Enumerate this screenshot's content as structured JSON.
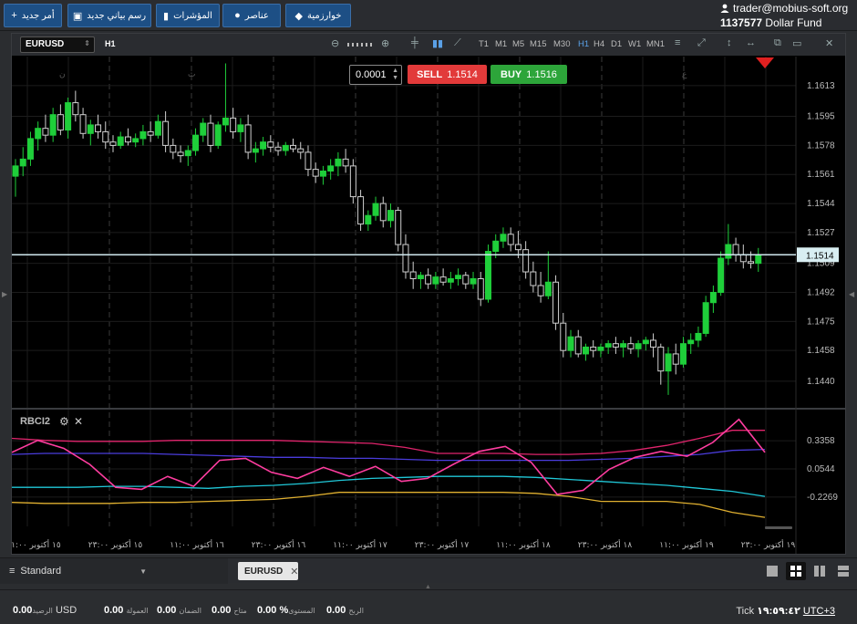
{
  "topbar": {
    "buttons": [
      {
        "label": "أمر جديد",
        "icon": "plus-icon",
        "glyph": "+"
      },
      {
        "label": "رسم بياني جديد",
        "icon": "chart-icon",
        "glyph": "▣"
      },
      {
        "label": "المؤشرات",
        "icon": "indicators-icon",
        "glyph": "▮"
      },
      {
        "label": "عناصر",
        "icon": "objects-icon",
        "glyph": "●"
      },
      {
        "label": "خوارزمية",
        "icon": "algorithm-icon",
        "glyph": "◆"
      }
    ],
    "account": {
      "user": "trader@mobius-soft.org",
      "number": "1137577",
      "fund": "Dollar Fund"
    }
  },
  "chart": {
    "symbol": "EURUSD",
    "timeframe_label": "H1",
    "timeframes": [
      "T1",
      "M1",
      "M5",
      "M15",
      "M30",
      "H1",
      "H4",
      "D1",
      "W1",
      "MN1"
    ],
    "active_timeframe": "H1",
    "lot": "0.0001",
    "sell": {
      "label": "SELL",
      "price": "1.1514"
    },
    "buy": {
      "label": "BUY",
      "price": "1.1516"
    },
    "indicator_name": "RBCI2",
    "current_price_label": "1.1514",
    "colors": {
      "bull": "#1fcf3a",
      "price_line": "#cfe8ee",
      "sell": "#e23a3a",
      "buy": "#2da53a"
    }
  },
  "chart_data": [
    {
      "type": "candlestick",
      "title": "",
      "symbol": "EURUSD",
      "ylim": [
        1.1425,
        1.163
      ],
      "yticks": [
        1.1613,
        1.1595,
        1.1578,
        1.1561,
        1.1544,
        1.1527,
        1.1509,
        1.1492,
        1.1475,
        1.1458,
        1.144
      ],
      "current_price": 1.1514,
      "grid": true,
      "session_markers": [
        "ن",
        "ث",
        "ع"
      ],
      "candles": [
        [
          1.156,
          1.157,
          1.1548,
          1.1566
        ],
        [
          1.1566,
          1.1577,
          1.156,
          1.157
        ],
        [
          1.157,
          1.1586,
          1.1566,
          1.1582
        ],
        [
          1.1582,
          1.1592,
          1.1575,
          1.1588
        ],
        [
          1.1588,
          1.1596,
          1.158,
          1.1584
        ],
        [
          1.1584,
          1.16,
          1.158,
          1.1596
        ],
        [
          1.1596,
          1.1602,
          1.1584,
          1.1587
        ],
        [
          1.1587,
          1.1606,
          1.1582,
          1.1603
        ],
        [
          1.1603,
          1.161,
          1.1592,
          1.1596
        ],
        [
          1.1596,
          1.16,
          1.1582,
          1.1585
        ],
        [
          1.1585,
          1.1593,
          1.1578,
          1.159
        ],
        [
          1.159,
          1.1596,
          1.1582,
          1.1586
        ],
        [
          1.1586,
          1.1592,
          1.1576,
          1.158
        ],
        [
          1.158,
          1.1584,
          1.1574,
          1.1578
        ],
        [
          1.1578,
          1.1586,
          1.1576,
          1.1583
        ],
        [
          1.1583,
          1.1588,
          1.1578,
          1.158
        ],
        [
          1.158,
          1.1585,
          1.1577,
          1.1582
        ],
        [
          1.1582,
          1.159,
          1.1578,
          1.1586
        ],
        [
          1.1586,
          1.1592,
          1.158,
          1.1584
        ],
        [
          1.1584,
          1.1596,
          1.1582,
          1.1592
        ],
        [
          1.1592,
          1.1598,
          1.1574,
          1.1578
        ],
        [
          1.1578,
          1.1582,
          1.157,
          1.1574
        ],
        [
          1.1574,
          1.1578,
          1.1568,
          1.1572
        ],
        [
          1.1572,
          1.1578,
          1.1566,
          1.1575
        ],
        [
          1.1575,
          1.1588,
          1.1572,
          1.1584
        ],
        [
          1.1584,
          1.1594,
          1.158,
          1.1591
        ],
        [
          1.1591,
          1.1596,
          1.1574,
          1.1578
        ],
        [
          1.1578,
          1.1592,
          1.1576,
          1.159
        ],
        [
          1.159,
          1.1626,
          1.1586,
          1.1594
        ],
        [
          1.1594,
          1.16,
          1.1582,
          1.1586
        ],
        [
          1.1586,
          1.1594,
          1.158,
          1.159
        ],
        [
          1.159,
          1.1596,
          1.157,
          1.1574
        ],
        [
          1.1574,
          1.158,
          1.1568,
          1.1576
        ],
        [
          1.1576,
          1.1583,
          1.1572,
          1.158
        ],
        [
          1.158,
          1.1584,
          1.1574,
          1.1577
        ],
        [
          1.1577,
          1.158,
          1.1572,
          1.1575
        ],
        [
          1.1575,
          1.158,
          1.1572,
          1.1578
        ],
        [
          1.1578,
          1.1582,
          1.1574,
          1.1576
        ],
        [
          1.1576,
          1.158,
          1.157,
          1.1574
        ],
        [
          1.1574,
          1.1578,
          1.156,
          1.1564
        ],
        [
          1.1564,
          1.1568,
          1.1556,
          1.156
        ],
        [
          1.156,
          1.1566,
          1.1555,
          1.1563
        ],
        [
          1.1563,
          1.157,
          1.1558,
          1.1566
        ],
        [
          1.1566,
          1.1574,
          1.156,
          1.157
        ],
        [
          1.157,
          1.1576,
          1.1562,
          1.1566
        ],
        [
          1.1566,
          1.157,
          1.1544,
          1.1548
        ],
        [
          1.1548,
          1.1552,
          1.1528,
          1.1532
        ],
        [
          1.1532,
          1.154,
          1.1528,
          1.1537
        ],
        [
          1.1537,
          1.1548,
          1.1534,
          1.1544
        ],
        [
          1.1544,
          1.1548,
          1.153,
          1.1534
        ],
        [
          1.1534,
          1.1544,
          1.153,
          1.154
        ],
        [
          1.154,
          1.1542,
          1.1516,
          1.152
        ],
        [
          1.152,
          1.1526,
          1.15,
          1.1504
        ],
        [
          1.1504,
          1.151,
          1.1494,
          1.15
        ],
        [
          1.15,
          1.1504,
          1.1494,
          1.1502
        ],
        [
          1.1502,
          1.1506,
          1.1494,
          1.1497
        ],
        [
          1.1497,
          1.1504,
          1.1494,
          1.1501
        ],
        [
          1.1501,
          1.1506,
          1.1496,
          1.1498
        ],
        [
          1.1498,
          1.1504,
          1.1494,
          1.15
        ],
        [
          1.15,
          1.1506,
          1.1496,
          1.1502
        ],
        [
          1.1502,
          1.1504,
          1.1494,
          1.1497
        ],
        [
          1.1497,
          1.1504,
          1.1494,
          1.15
        ],
        [
          1.15,
          1.1504,
          1.1484,
          1.1488
        ],
        [
          1.1488,
          1.152,
          1.1486,
          1.1516
        ],
        [
          1.1516,
          1.1526,
          1.1512,
          1.1522
        ],
        [
          1.1522,
          1.153,
          1.1518,
          1.1526
        ],
        [
          1.1526,
          1.153,
          1.1516,
          1.152
        ],
        [
          1.152,
          1.1528,
          1.1512,
          1.1517
        ],
        [
          1.1517,
          1.1522,
          1.15,
          1.1504
        ],
        [
          1.1504,
          1.151,
          1.1492,
          1.1496
        ],
        [
          1.1496,
          1.1504,
          1.1486,
          1.149
        ],
        [
          1.149,
          1.1516,
          1.1488,
          1.1498
        ],
        [
          1.1498,
          1.1502,
          1.147,
          1.1474
        ],
        [
          1.1474,
          1.148,
          1.1454,
          1.1458
        ],
        [
          1.1458,
          1.147,
          1.1454,
          1.1466
        ],
        [
          1.1466,
          1.147,
          1.1454,
          1.1456
        ],
        [
          1.1456,
          1.1462,
          1.1452,
          1.146
        ],
        [
          1.146,
          1.1464,
          1.1454,
          1.1458
        ],
        [
          1.1458,
          1.1462,
          1.1454,
          1.146
        ],
        [
          1.146,
          1.1464,
          1.1456,
          1.1462
        ],
        [
          1.1462,
          1.1466,
          1.1456,
          1.146
        ],
        [
          1.146,
          1.1464,
          1.1454,
          1.1462
        ],
        [
          1.1462,
          1.1466,
          1.1456,
          1.1459
        ],
        [
          1.1459,
          1.1464,
          1.1454,
          1.1462
        ],
        [
          1.1462,
          1.1466,
          1.1458,
          1.1464
        ],
        [
          1.1464,
          1.1468,
          1.1454,
          1.146
        ],
        [
          1.146,
          1.1462,
          1.1438,
          1.1446
        ],
        [
          1.1446,
          1.146,
          1.1432,
          1.1456
        ],
        [
          1.1456,
          1.1462,
          1.1444,
          1.145
        ],
        [
          1.145,
          1.1466,
          1.1448,
          1.1462
        ],
        [
          1.1462,
          1.1468,
          1.1456,
          1.1464
        ],
        [
          1.1464,
          1.1472,
          1.146,
          1.1468
        ],
        [
          1.1468,
          1.149,
          1.1466,
          1.1486
        ],
        [
          1.1486,
          1.1496,
          1.148,
          1.1492
        ],
        [
          1.1492,
          1.1516,
          1.149,
          1.1512
        ],
        [
          1.1512,
          1.1532,
          1.1508,
          1.152
        ],
        [
          1.152,
          1.1524,
          1.151,
          1.1514
        ],
        [
          1.1514,
          1.152,
          1.1506,
          1.151
        ],
        [
          1.151,
          1.1516,
          1.1506,
          1.1509
        ],
        [
          1.1509,
          1.1518,
          1.1504,
          1.1514
        ]
      ]
    },
    {
      "type": "line",
      "title": "RBCI2",
      "ylim": [
        -0.52,
        0.62
      ],
      "yticks": [
        0.3358,
        0.0544,
        -0.2269
      ],
      "x_labels": [
        "١٥ أكتوبر ١١:٠٠",
        "١٥ أكتوبر ٢٣:٠٠",
        "١٦ أكتوبر ١١:٠٠",
        "١٦ أكتوبر ٢٣:٠٠",
        "١٧ أكتوبر ١١:٠٠",
        "١٧ أكتوبر ٢٣:٠٠",
        "١٨ أكتوبر ١١:٠٠",
        "١٨ أكتوبر ٢٣:٠٠",
        "١٩ أكتوبر ١١:٠٠",
        "١٩ أكتوبر ٢٣:٠٠"
      ],
      "series": [
        {
          "color": "#e0246c",
          "values": [
            0.36,
            0.34,
            0.33,
            0.33,
            0.33,
            0.34,
            0.34,
            0.34,
            0.34,
            0.33,
            0.32,
            0.31,
            0.27,
            0.21,
            0.21,
            0.21,
            0.2,
            0.2,
            0.21,
            0.24,
            0.29,
            0.36,
            0.44,
            0.44
          ]
        },
        {
          "color": "#4a3cdc",
          "values": [
            0.2,
            0.21,
            0.21,
            0.21,
            0.21,
            0.2,
            0.19,
            0.18,
            0.17,
            0.17,
            0.16,
            0.16,
            0.15,
            0.14,
            0.14,
            0.14,
            0.14,
            0.14,
            0.15,
            0.16,
            0.18,
            0.2,
            0.24,
            0.25
          ]
        },
        {
          "color": "#20c8d8",
          "values": [
            -0.13,
            -0.13,
            -0.13,
            -0.12,
            -0.12,
            -0.13,
            -0.14,
            -0.12,
            -0.11,
            -0.09,
            -0.06,
            -0.04,
            -0.03,
            -0.02,
            -0.02,
            -0.02,
            -0.03,
            -0.05,
            -0.07,
            -0.09,
            -0.11,
            -0.14,
            -0.17,
            -0.22
          ]
        },
        {
          "color": "#e0b030",
          "values": [
            -0.28,
            -0.29,
            -0.29,
            -0.29,
            -0.28,
            -0.28,
            -0.27,
            -0.26,
            -0.25,
            -0.22,
            -0.18,
            -0.18,
            -0.18,
            -0.18,
            -0.18,
            -0.18,
            -0.19,
            -0.22,
            -0.27,
            -0.27,
            -0.27,
            -0.3,
            -0.38,
            -0.43
          ]
        },
        {
          "color": "#ff3da0",
          "values": [
            0.22,
            0.34,
            0.26,
            0.1,
            -0.13,
            -0.15,
            -0.02,
            -0.12,
            0.14,
            0.16,
            0.02,
            -0.04,
            0.07,
            -0.02,
            0.08,
            -0.07,
            -0.04,
            0.1,
            0.23,
            0.28,
            0.12,
            -0.2,
            -0.16,
            0.05,
            0.17,
            0.23,
            0.18,
            0.32,
            0.55,
            0.22
          ]
        }
      ]
    }
  ],
  "bottombar": {
    "template": "Standard",
    "symbol_tab": "EURUSD",
    "layouts": [
      "layout-single-icon",
      "layout-grid-icon",
      "layout-columns-icon",
      "layout-rows-icon"
    ]
  },
  "status": {
    "balance_value": "0.00",
    "balance_label": "الرصيد",
    "currency": "USD",
    "commission_value": "0.00",
    "commission_label": "العمولة",
    "margin_value": "0.00",
    "margin_label": "الضمان",
    "available_value": "0.00",
    "available_label": "متاح",
    "level_value": "0.00",
    "level_pct": "%",
    "level_label": "المستوى",
    "profit_value": "0.00",
    "profit_label": "الربح",
    "tick": "Tick",
    "time": "١٩:٥٩:٤٢",
    "tz": "UTC+3"
  }
}
